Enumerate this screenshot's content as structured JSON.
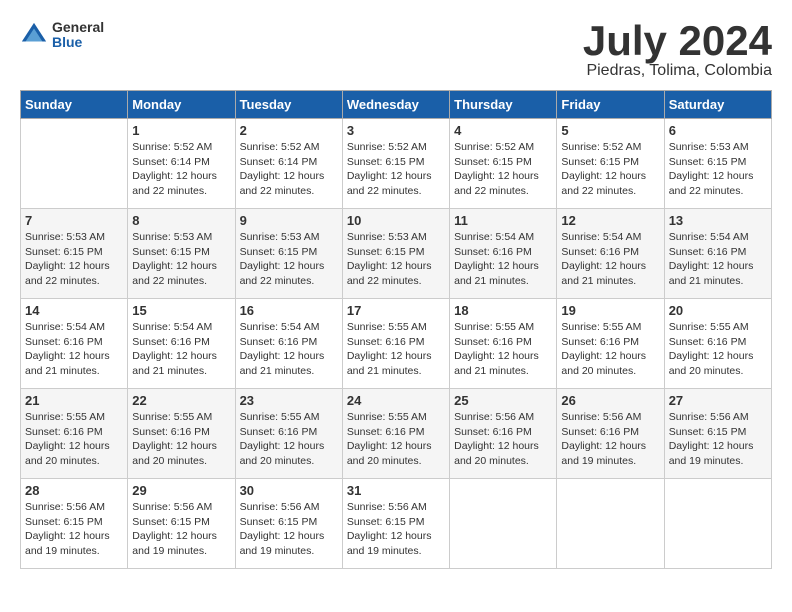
{
  "header": {
    "logo_general": "General",
    "logo_blue": "Blue",
    "month_title": "July 2024",
    "location": "Piedras, Tolima, Colombia"
  },
  "calendar": {
    "days_of_week": [
      "Sunday",
      "Monday",
      "Tuesday",
      "Wednesday",
      "Thursday",
      "Friday",
      "Saturday"
    ],
    "weeks": [
      [
        {
          "day": "",
          "sunrise": "",
          "sunset": "",
          "daylight": ""
        },
        {
          "day": "1",
          "sunrise": "Sunrise: 5:52 AM",
          "sunset": "Sunset: 6:14 PM",
          "daylight": "Daylight: 12 hours and 22 minutes."
        },
        {
          "day": "2",
          "sunrise": "Sunrise: 5:52 AM",
          "sunset": "Sunset: 6:14 PM",
          "daylight": "Daylight: 12 hours and 22 minutes."
        },
        {
          "day": "3",
          "sunrise": "Sunrise: 5:52 AM",
          "sunset": "Sunset: 6:15 PM",
          "daylight": "Daylight: 12 hours and 22 minutes."
        },
        {
          "day": "4",
          "sunrise": "Sunrise: 5:52 AM",
          "sunset": "Sunset: 6:15 PM",
          "daylight": "Daylight: 12 hours and 22 minutes."
        },
        {
          "day": "5",
          "sunrise": "Sunrise: 5:52 AM",
          "sunset": "Sunset: 6:15 PM",
          "daylight": "Daylight: 12 hours and 22 minutes."
        },
        {
          "day": "6",
          "sunrise": "Sunrise: 5:53 AM",
          "sunset": "Sunset: 6:15 PM",
          "daylight": "Daylight: 12 hours and 22 minutes."
        }
      ],
      [
        {
          "day": "7",
          "sunrise": "Sunrise: 5:53 AM",
          "sunset": "Sunset: 6:15 PM",
          "daylight": "Daylight: 12 hours and 22 minutes."
        },
        {
          "day": "8",
          "sunrise": "Sunrise: 5:53 AM",
          "sunset": "Sunset: 6:15 PM",
          "daylight": "Daylight: 12 hours and 22 minutes."
        },
        {
          "day": "9",
          "sunrise": "Sunrise: 5:53 AM",
          "sunset": "Sunset: 6:15 PM",
          "daylight": "Daylight: 12 hours and 22 minutes."
        },
        {
          "day": "10",
          "sunrise": "Sunrise: 5:53 AM",
          "sunset": "Sunset: 6:15 PM",
          "daylight": "Daylight: 12 hours and 22 minutes."
        },
        {
          "day": "11",
          "sunrise": "Sunrise: 5:54 AM",
          "sunset": "Sunset: 6:16 PM",
          "daylight": "Daylight: 12 hours and 21 minutes."
        },
        {
          "day": "12",
          "sunrise": "Sunrise: 5:54 AM",
          "sunset": "Sunset: 6:16 PM",
          "daylight": "Daylight: 12 hours and 21 minutes."
        },
        {
          "day": "13",
          "sunrise": "Sunrise: 5:54 AM",
          "sunset": "Sunset: 6:16 PM",
          "daylight": "Daylight: 12 hours and 21 minutes."
        }
      ],
      [
        {
          "day": "14",
          "sunrise": "Sunrise: 5:54 AM",
          "sunset": "Sunset: 6:16 PM",
          "daylight": "Daylight: 12 hours and 21 minutes."
        },
        {
          "day": "15",
          "sunrise": "Sunrise: 5:54 AM",
          "sunset": "Sunset: 6:16 PM",
          "daylight": "Daylight: 12 hours and 21 minutes."
        },
        {
          "day": "16",
          "sunrise": "Sunrise: 5:54 AM",
          "sunset": "Sunset: 6:16 PM",
          "daylight": "Daylight: 12 hours and 21 minutes."
        },
        {
          "day": "17",
          "sunrise": "Sunrise: 5:55 AM",
          "sunset": "Sunset: 6:16 PM",
          "daylight": "Daylight: 12 hours and 21 minutes."
        },
        {
          "day": "18",
          "sunrise": "Sunrise: 5:55 AM",
          "sunset": "Sunset: 6:16 PM",
          "daylight": "Daylight: 12 hours and 21 minutes."
        },
        {
          "day": "19",
          "sunrise": "Sunrise: 5:55 AM",
          "sunset": "Sunset: 6:16 PM",
          "daylight": "Daylight: 12 hours and 20 minutes."
        },
        {
          "day": "20",
          "sunrise": "Sunrise: 5:55 AM",
          "sunset": "Sunset: 6:16 PM",
          "daylight": "Daylight: 12 hours and 20 minutes."
        }
      ],
      [
        {
          "day": "21",
          "sunrise": "Sunrise: 5:55 AM",
          "sunset": "Sunset: 6:16 PM",
          "daylight": "Daylight: 12 hours and 20 minutes."
        },
        {
          "day": "22",
          "sunrise": "Sunrise: 5:55 AM",
          "sunset": "Sunset: 6:16 PM",
          "daylight": "Daylight: 12 hours and 20 minutes."
        },
        {
          "day": "23",
          "sunrise": "Sunrise: 5:55 AM",
          "sunset": "Sunset: 6:16 PM",
          "daylight": "Daylight: 12 hours and 20 minutes."
        },
        {
          "day": "24",
          "sunrise": "Sunrise: 5:55 AM",
          "sunset": "Sunset: 6:16 PM",
          "daylight": "Daylight: 12 hours and 20 minutes."
        },
        {
          "day": "25",
          "sunrise": "Sunrise: 5:56 AM",
          "sunset": "Sunset: 6:16 PM",
          "daylight": "Daylight: 12 hours and 20 minutes."
        },
        {
          "day": "26",
          "sunrise": "Sunrise: 5:56 AM",
          "sunset": "Sunset: 6:16 PM",
          "daylight": "Daylight: 12 hours and 19 minutes."
        },
        {
          "day": "27",
          "sunrise": "Sunrise: 5:56 AM",
          "sunset": "Sunset: 6:15 PM",
          "daylight": "Daylight: 12 hours and 19 minutes."
        }
      ],
      [
        {
          "day": "28",
          "sunrise": "Sunrise: 5:56 AM",
          "sunset": "Sunset: 6:15 PM",
          "daylight": "Daylight: 12 hours and 19 minutes."
        },
        {
          "day": "29",
          "sunrise": "Sunrise: 5:56 AM",
          "sunset": "Sunset: 6:15 PM",
          "daylight": "Daylight: 12 hours and 19 minutes."
        },
        {
          "day": "30",
          "sunrise": "Sunrise: 5:56 AM",
          "sunset": "Sunset: 6:15 PM",
          "daylight": "Daylight: 12 hours and 19 minutes."
        },
        {
          "day": "31",
          "sunrise": "Sunrise: 5:56 AM",
          "sunset": "Sunset: 6:15 PM",
          "daylight": "Daylight: 12 hours and 19 minutes."
        },
        {
          "day": "",
          "sunrise": "",
          "sunset": "",
          "daylight": ""
        },
        {
          "day": "",
          "sunrise": "",
          "sunset": "",
          "daylight": ""
        },
        {
          "day": "",
          "sunrise": "",
          "sunset": "",
          "daylight": ""
        }
      ]
    ]
  }
}
